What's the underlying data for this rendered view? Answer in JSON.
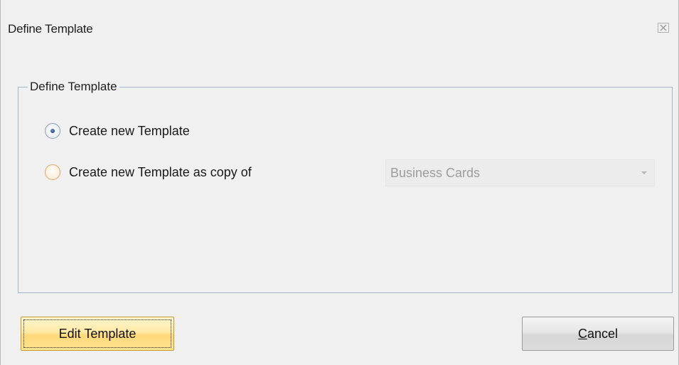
{
  "window": {
    "title": "Define Template",
    "close_icon": "close-icon"
  },
  "group": {
    "legend": "Define Template"
  },
  "options": {
    "create_new": {
      "label": "Create new Template",
      "selected": true
    },
    "create_copy": {
      "label": "Create new Template as copy of",
      "selected": false
    }
  },
  "template_select": {
    "value": "Business Cards",
    "enabled": false
  },
  "buttons": {
    "edit_label": "Edit Template",
    "cancel_mnemonic": "C",
    "cancel_rest": "ancel"
  },
  "colors": {
    "accent_button": "#ffe38e",
    "dialog_background": "#f0f0f0",
    "disabled_text": "#9c9c9c"
  }
}
